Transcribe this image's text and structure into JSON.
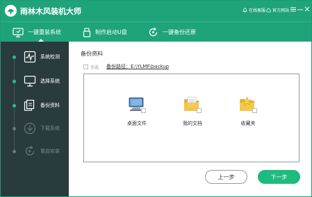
{
  "window": {
    "title": "雨林木风装机大师",
    "links": [
      {
        "label": "在线客服",
        "icon": "bell-icon"
      },
      {
        "label": "官方网站",
        "icon": "home-icon"
      }
    ],
    "controls": [
      "menu-icon",
      "minimize-icon",
      "close-icon"
    ]
  },
  "nav": {
    "tabs": [
      {
        "label": "一键重装系统",
        "icon": "monitor-icon",
        "active": true
      },
      {
        "label": "制作启动U盘",
        "icon": "usb-drive-icon",
        "active": false
      },
      {
        "label": "一键备份还原",
        "icon": "backup-restore-icon",
        "active": false
      }
    ]
  },
  "sidebar": {
    "steps": [
      {
        "label": "系统检测",
        "icon": "system-check-icon",
        "state": "done"
      },
      {
        "label": "选择系统",
        "icon": "select-system-icon",
        "state": "done"
      },
      {
        "label": "备份资料",
        "icon": "backup-data-icon",
        "state": "done"
      },
      {
        "label": "下载系统",
        "icon": "download-icon",
        "state": "todo"
      },
      {
        "label": "重启安装",
        "icon": "restart-icon",
        "state": "todo"
      }
    ]
  },
  "main": {
    "section_title": "备份资料",
    "select_all_label": "全选",
    "backup_path": "备份路径：E:\\YLMF\\backup",
    "items": [
      {
        "label": "桌面文件",
        "icon": "desktop-computer-icon"
      },
      {
        "label": "我的文档",
        "icon": "documents-folder-icon"
      },
      {
        "label": "收藏夹",
        "icon": "favorites-folder-icon"
      }
    ],
    "prev_label": "上一步",
    "next_label": "下一步"
  },
  "colors": {
    "accent": "#1fa37a",
    "sidebar": "#2a3b3d",
    "next_button": "#1fba7e",
    "step_done": "#1fc38a"
  }
}
